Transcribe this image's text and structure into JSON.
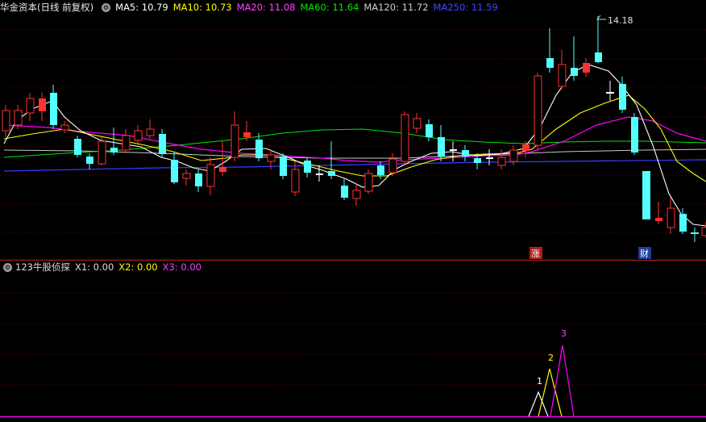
{
  "main_header": {
    "title": "华金资本(日线 前复权)",
    "ma5": "MA5: 10.79",
    "ma10": "MA10: 10.73",
    "ma20": "MA20: 11.08",
    "ma60": "MA60: 11.64",
    "ma120": "MA120: 11.72",
    "ma250": "MA250: 11.59"
  },
  "main_chart": {
    "peak_label": "14.18",
    "marker_zhang": "涨",
    "marker_cai": "财"
  },
  "indicator_header": {
    "title": "123牛股侦探",
    "x1": "X1: 0.00",
    "x2": "X2: 0.00",
    "x3": "X3: 0.00"
  },
  "indicator_chart": {
    "label1": "1",
    "label2": "2",
    "label3": "3"
  },
  "colors": {
    "up": "#ff3232",
    "down": "#54ffff",
    "ma5": "#ffffff",
    "ma10": "#ffff00",
    "ma20": "#ff00ff",
    "ma60": "#00e600",
    "ma120": "#c8c8c8",
    "ma250": "#3c3cff"
  }
}
